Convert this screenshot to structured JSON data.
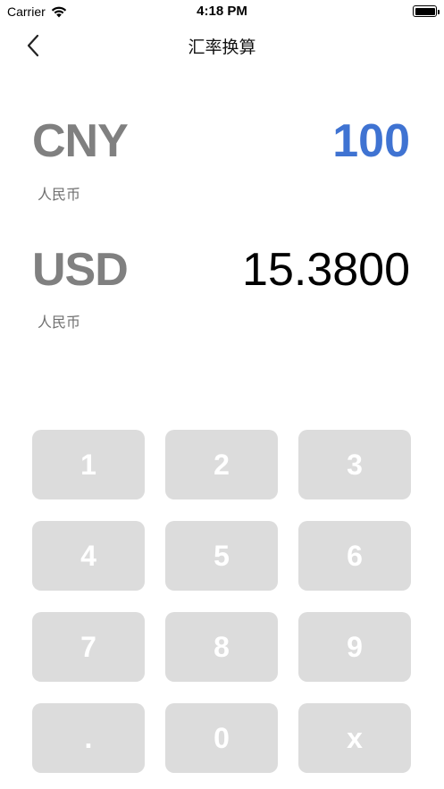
{
  "status_bar": {
    "carrier": "Carrier",
    "time": "4:18 PM"
  },
  "nav": {
    "title": "汇率换算",
    "back_icon": "chevron-left-icon"
  },
  "from": {
    "code": "CNY",
    "name": "人民币",
    "amount": "100"
  },
  "to": {
    "code": "USD",
    "name": "人民币",
    "amount": "15.3800"
  },
  "keypad": {
    "keys": [
      "1",
      "2",
      "3",
      "4",
      "5",
      "6",
      "7",
      "8",
      "9",
      ".",
      "0",
      "x"
    ]
  },
  "colors": {
    "accent": "#3f73d2",
    "key_bg": "#dcdcdc",
    "code_gray": "#808080"
  }
}
